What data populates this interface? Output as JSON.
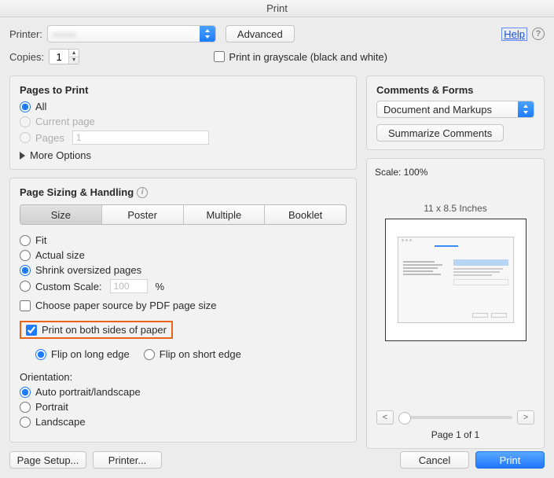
{
  "title": "Print",
  "top": {
    "printer_label": "Printer:",
    "printer_value": "-------",
    "advanced": "Advanced",
    "help": "Help",
    "copies_label": "Copies:",
    "copies_value": "1",
    "grayscale": "Print in grayscale (black and white)"
  },
  "pages_to_print": {
    "title": "Pages to Print",
    "all": "All",
    "current": "Current page",
    "pages": "Pages",
    "pages_value": "1",
    "more": "More Options"
  },
  "sizing": {
    "title": "Page Sizing & Handling",
    "tabs": {
      "size": "Size",
      "poster": "Poster",
      "multiple": "Multiple",
      "booklet": "Booklet"
    },
    "fit": "Fit",
    "actual": "Actual size",
    "shrink": "Shrink oversized pages",
    "custom": "Custom Scale:",
    "custom_value": "100",
    "percent": "%",
    "choose_paper": "Choose paper source by PDF page size",
    "both_sides": "Print on both sides of paper",
    "flip_long": "Flip on long edge",
    "flip_short": "Flip on short edge",
    "orientation": "Orientation:",
    "auto": "Auto portrait/landscape",
    "portrait": "Portrait",
    "landscape": "Landscape"
  },
  "comments": {
    "title": "Comments & Forms",
    "value": "Document and Markups",
    "summarize": "Summarize Comments"
  },
  "preview": {
    "scale": "Scale: 100%",
    "dims": "11 x 8.5 Inches",
    "counter": "Page 1 of 1"
  },
  "bottom": {
    "page_setup": "Page Setup...",
    "printer_btn": "Printer...",
    "cancel": "Cancel",
    "print": "Print"
  }
}
